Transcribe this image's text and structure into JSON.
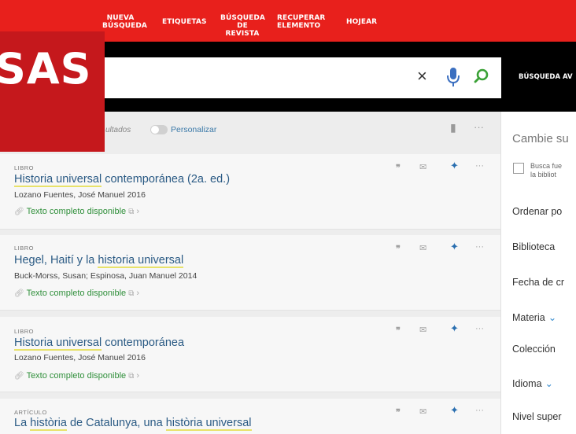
{
  "nav": {
    "items": [
      {
        "line1": "NUEVA",
        "line2": "BÚSQUEDA"
      },
      {
        "line1": "ETIQUETAS",
        "line2": ""
      },
      {
        "line1": "BÚSQUEDA",
        "line2": "DE REVISTA"
      },
      {
        "line1": "RECUPERAR",
        "line2": "ELEMENTO"
      },
      {
        "line1": "HOJEAR",
        "line2": ""
      }
    ]
  },
  "search": {
    "value": "",
    "clear_glyph": "×",
    "advanced_label": "BÚSQUEDA AV"
  },
  "overlay": {
    "text": "SAS"
  },
  "toolbar": {
    "results_label": "ultados",
    "personalize_label": "Personalizar",
    "more_glyph": "···"
  },
  "results": [
    {
      "type": "LIBRO",
      "title_parts": [
        {
          "text": "Historia universal",
          "hl": true
        },
        {
          "text": " contemporánea (2a. ed.)",
          "hl": false
        }
      ],
      "authors": "Lozano Fuentes, José Manuel 2016",
      "fulltext": "Texto completo disponible"
    },
    {
      "type": "LIBRO",
      "title_parts": [
        {
          "text": "Hegel, Haití y la ",
          "hl": false
        },
        {
          "text": "historia universal",
          "hl": true
        }
      ],
      "authors": "Buck-Morss, Susan; Espinosa, Juan Manuel 2014",
      "fulltext": "Texto completo disponible"
    },
    {
      "type": "LIBRO",
      "title_parts": [
        {
          "text": "Historia universal",
          "hl": true
        },
        {
          "text": " contemporánea",
          "hl": false
        }
      ],
      "authors": "Lozano Fuentes, José Manuel 2016",
      "fulltext": "Texto completo disponible"
    },
    {
      "type": "ARTÍCULO",
      "title_parts": [
        {
          "text": "La ",
          "hl": false
        },
        {
          "text": "història",
          "hl": true
        },
        {
          "text": " de Catalunya, una ",
          "hl": false
        },
        {
          "text": "història universal",
          "hl": true
        }
      ],
      "authors": "",
      "fulltext": ""
    }
  ],
  "actions": {
    "quote_glyph": "❞",
    "mail_glyph": "✉",
    "pin_glyph": "📌",
    "more_glyph": "···"
  },
  "sidepanel": {
    "title": "Cambie su",
    "checkbox_line1": "Busca fue",
    "checkbox_line2": "la bibliot",
    "items": [
      {
        "label": "Ordenar po",
        "chevron": false
      },
      {
        "label": "Biblioteca",
        "chevron": false
      },
      {
        "label": "Fecha de cr",
        "chevron": false
      },
      {
        "label": "Materia",
        "chevron": true
      },
      {
        "label": "Colección",
        "chevron": false
      },
      {
        "label": "Idioma",
        "chevron": true
      },
      {
        "label": "Nivel super",
        "chevron": false
      }
    ]
  },
  "colors": {
    "nav_bg": "#e8201c",
    "overlay_bg": "#c5181c",
    "link": "#2a5a84",
    "fulltext": "#2f8f3a",
    "highlight": "#e8e26a"
  }
}
